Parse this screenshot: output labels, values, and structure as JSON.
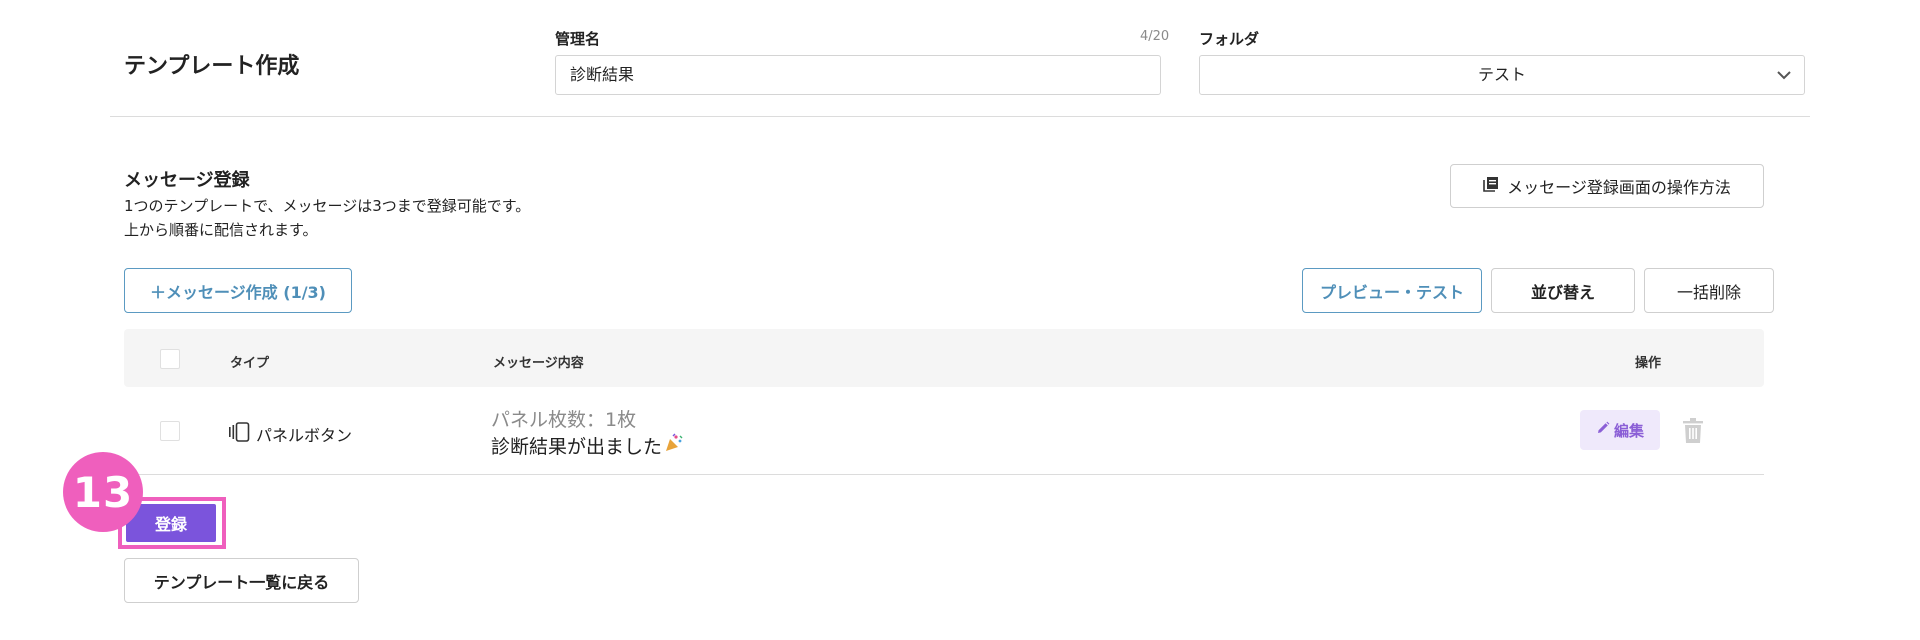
{
  "header": {
    "page_title": "テンプレート作成",
    "name_label": "管理名",
    "name_counter": "4/20",
    "name_value": "診断結果",
    "folder_label": "フォルダ",
    "folder_value": "テスト",
    "folder_icon": "chevron-down-icon"
  },
  "message_section": {
    "title": "メッセージ登録",
    "desc_line1": "1つのテンプレートで、メッセージは3つまで登録可能です。",
    "desc_line2": "上から順番に配信されます。",
    "howto_label": "メッセージ登録画面の操作方法",
    "howto_icon": "book-icon"
  },
  "toolbar": {
    "create_label": "＋メッセージ作成 (1/3)",
    "preview_label": "プレビュー・テスト",
    "sort_label": "並び替え",
    "bulk_delete_label": "一括削除"
  },
  "table": {
    "headers": {
      "type": "タイプ",
      "content": "メッセージ内容",
      "actions": "操作"
    },
    "rows": [
      {
        "type_icon": "panel-icon",
        "type": "パネルボタン",
        "content_line1": "パネル枚数：1枚",
        "content_line2": "診断結果が出ました",
        "content_emoji": "party-popper-icon",
        "edit_label": "編集",
        "edit_icon": "pencil-icon",
        "delete_icon": "trash-icon"
      }
    ]
  },
  "footer": {
    "register_label": "登録",
    "back_label": "テンプレート一覧に戻る",
    "step_badge": "13"
  },
  "colors": {
    "accent_purple": "#7b54dc",
    "highlight_pink": "#ef5fbd",
    "outline_blue": "#4f8fb8",
    "edit_bg": "#efe9fb"
  }
}
